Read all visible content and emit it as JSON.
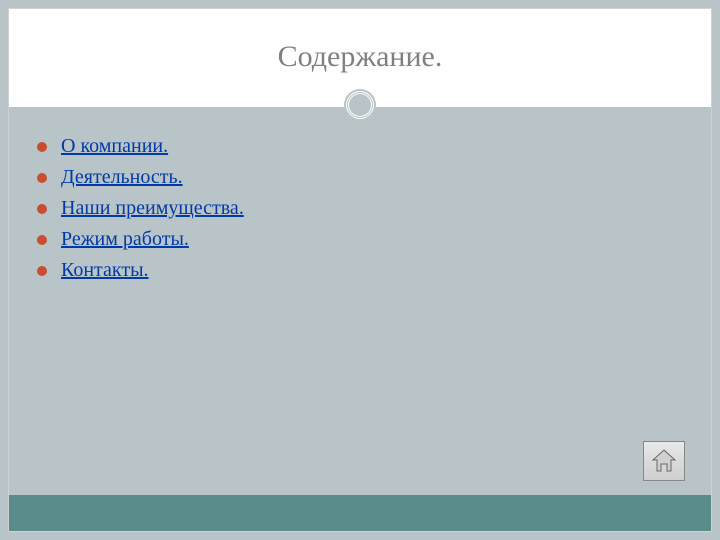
{
  "title": "Содержание.",
  "toc": {
    "items": [
      {
        "label": "О компании."
      },
      {
        "label": "Деятельность."
      },
      {
        "label": "Наши преимущества."
      },
      {
        "label": "Режим работы."
      },
      {
        "label": "Контакты."
      }
    ]
  },
  "icons": {
    "home": "home-icon"
  },
  "colors": {
    "background": "#b8c4c7",
    "header_bg": "#ffffff",
    "title_text": "#808080",
    "bullet": "#c94d2f",
    "link": "#003aa8",
    "footer": "#5a8c8c"
  }
}
